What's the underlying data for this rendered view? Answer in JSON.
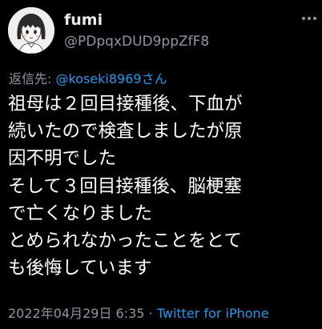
{
  "tweet": {
    "author": {
      "display_name": "fumi",
      "handle": "@PDpqxDUD9ppZfF8",
      "avatar_icon": "cartoon-girl-avatar"
    },
    "reply_prefix": "返信先: ",
    "reply_mention": "@koseki8969さん",
    "lines": [
      "祖母は２回目接種後、下血が",
      "続いたので検査しましたが原",
      "因不明でした",
      "そして３回目接種後、脳梗塞",
      "で亡くなりました",
      "とめられなかったことをとて",
      "も後悔しています"
    ],
    "timestamp": "2022年04月29日 6:35",
    "separator": " · ",
    "source": "Twitter for iPhone"
  },
  "colors": {
    "background": "#000000",
    "text": "#ffffff",
    "secondary": "#8b98a5",
    "accent": "#1d9bf0"
  }
}
